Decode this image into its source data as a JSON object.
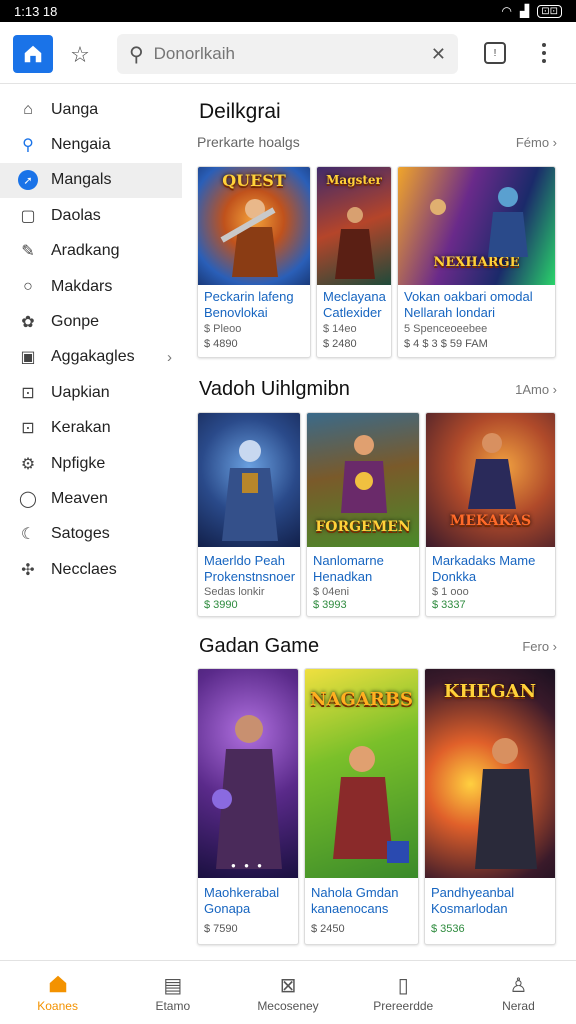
{
  "status": {
    "time": "1:13 18",
    "battery": "⊡⊡"
  },
  "topbar": {
    "search_placeholder": "Donorlkaih"
  },
  "sidebar": {
    "items": [
      {
        "label": "Uanga",
        "icon": "home-outline-icon"
      },
      {
        "label": "Nengaia",
        "icon": "search-icon"
      },
      {
        "label": "Mangals",
        "icon": "compass-icon",
        "active": true
      },
      {
        "label": "Daolas",
        "icon": "square-icon"
      },
      {
        "label": "Aradkang",
        "icon": "pencil-icon"
      },
      {
        "label": "Makdars",
        "icon": "circle-icon"
      },
      {
        "label": "Gonpe",
        "icon": "gamepad-icon"
      },
      {
        "label": "Aggakagles",
        "icon": "chat-icon",
        "has_chevron": true
      },
      {
        "label": "Uapkian",
        "icon": "square-dot-icon"
      },
      {
        "label": "Kerakan",
        "icon": "square-dot-icon"
      },
      {
        "label": "Npfigke",
        "icon": "gear-icon"
      },
      {
        "label": "Meaven",
        "icon": "speech-bubble-icon"
      },
      {
        "label": "Satoges",
        "icon": "leaf-icon"
      },
      {
        "label": "Necclaes",
        "icon": "puzzle-icon"
      }
    ]
  },
  "sections": [
    {
      "title": "Deilkgrai",
      "subtitle": "Prerkarte hoalgs",
      "more": "Fémo ›",
      "cards": [
        {
          "name": "Peckarin lafeng Benovlokai",
          "meta": "$ Pleoo",
          "price": "$ 4890",
          "art_title": "QUEST"
        },
        {
          "name": "Meclayana Catlexider",
          "meta": "$ 14eo",
          "price": "$ 2480",
          "art_title": "Magster"
        },
        {
          "name": "Vokan oakbari omodal Nellarah londari",
          "meta": "5 Spenceoeebee",
          "price": "$ 4 $ 3 $ 59 FAM",
          "art_title": "NEXHARGE"
        }
      ]
    },
    {
      "title": "Vadoh Uihlgmibn",
      "subtitle": "",
      "more": "1Amo ›",
      "cards": [
        {
          "name": "Maerldo Peah Prokenstnsnoer",
          "meta": "Sedas lonkir",
          "price": "$ 3990",
          "art_title": ""
        },
        {
          "name": "Nanlomarne Henadkan",
          "meta": "$ 04eni",
          "price": "$ 3993",
          "art_title": "FORGEMEN"
        },
        {
          "name": "Markadaks Mame Donkka",
          "meta": "$ 1 ooo",
          "price": "$ 3337",
          "art_title": "MEKAKAS"
        }
      ]
    },
    {
      "title": "Gadan Game",
      "subtitle": "",
      "more": "Fero ›",
      "cards": [
        {
          "name": "Maohkerabal Gonapa",
          "meta": "",
          "price": "$ 7590",
          "art_title": ""
        },
        {
          "name": "Nahola Gmdan kanaenocans",
          "meta": "",
          "price": "$ 2450",
          "art_title": "NAGARBS"
        },
        {
          "name": "Pandhyeanbal Kosmarlodan",
          "meta": "",
          "price": "$ 3536",
          "art_title": "KHEGAN"
        }
      ]
    }
  ],
  "bottom_nav": [
    {
      "label": "Koanes",
      "icon": "home-icon",
      "active": true
    },
    {
      "label": "Etamo",
      "icon": "calendar-icon"
    },
    {
      "label": "Mecoseney",
      "icon": "inbox-icon"
    },
    {
      "label": "Prereerdde",
      "icon": "clipboard-icon"
    },
    {
      "label": "Nerad",
      "icon": "person-icon"
    }
  ],
  "colors": {
    "accent": "#1a73e8",
    "nav_active": "#f39200",
    "link": "#1765c0"
  }
}
